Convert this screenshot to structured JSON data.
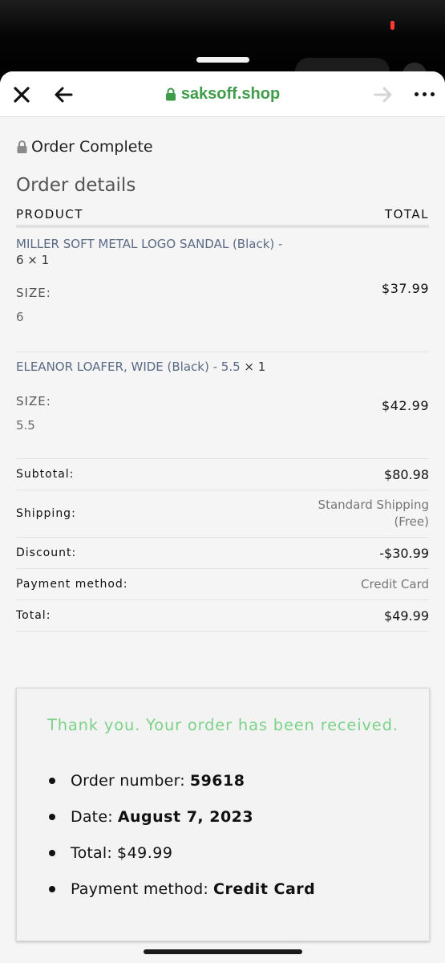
{
  "browser": {
    "url": "saksoff.shop"
  },
  "page": {
    "status_text": "Order Complete",
    "section_title": "Order details"
  },
  "table": {
    "col_product": "PRODUCT",
    "col_total": "TOTAL"
  },
  "items": [
    {
      "name": "MILLER SOFT METAL LOGO SANDAL (Black) -",
      "qty_line": "6 × 1",
      "size_label": "SIZE:",
      "size_value": "6",
      "price": "$37.99"
    },
    {
      "name": "ELEANOR LOAFER, WIDE (Black) - 5.5",
      "qty_line": " × 1",
      "size_label": "SIZE:",
      "size_value": "5.5",
      "price": "$42.99"
    }
  ],
  "totals": {
    "subtotal_label": "Subtotal:",
    "subtotal_value": "$80.98",
    "shipping_label": "Shipping:",
    "shipping_value_line1": "Standard Shipping",
    "shipping_value_line2": "(Free)",
    "discount_label": "Discount:",
    "discount_value": "-$30.99",
    "payment_label": "Payment method:",
    "payment_value": "Credit Card",
    "total_label": "Total:",
    "total_value": "$49.99"
  },
  "confirmation": {
    "thank_you": "Thank you. Your order has been received.",
    "order_number_label": "Order number:",
    "order_number": "59618",
    "date_label": "Date:",
    "date": "August 7, 2023",
    "total_label": "Total:",
    "total": "$49.99",
    "payment_label": "Payment method:",
    "payment": "Credit Card"
  },
  "colors": {
    "url_green": "#3f9d4a",
    "thank_you_green": "#7bd389",
    "product_link": "#5a6a85"
  },
  "icons": {
    "close": "close-icon",
    "back": "arrow-left-icon",
    "forward": "arrow-right-icon",
    "more": "more-horizontal-icon",
    "lock": "lock-icon"
  }
}
